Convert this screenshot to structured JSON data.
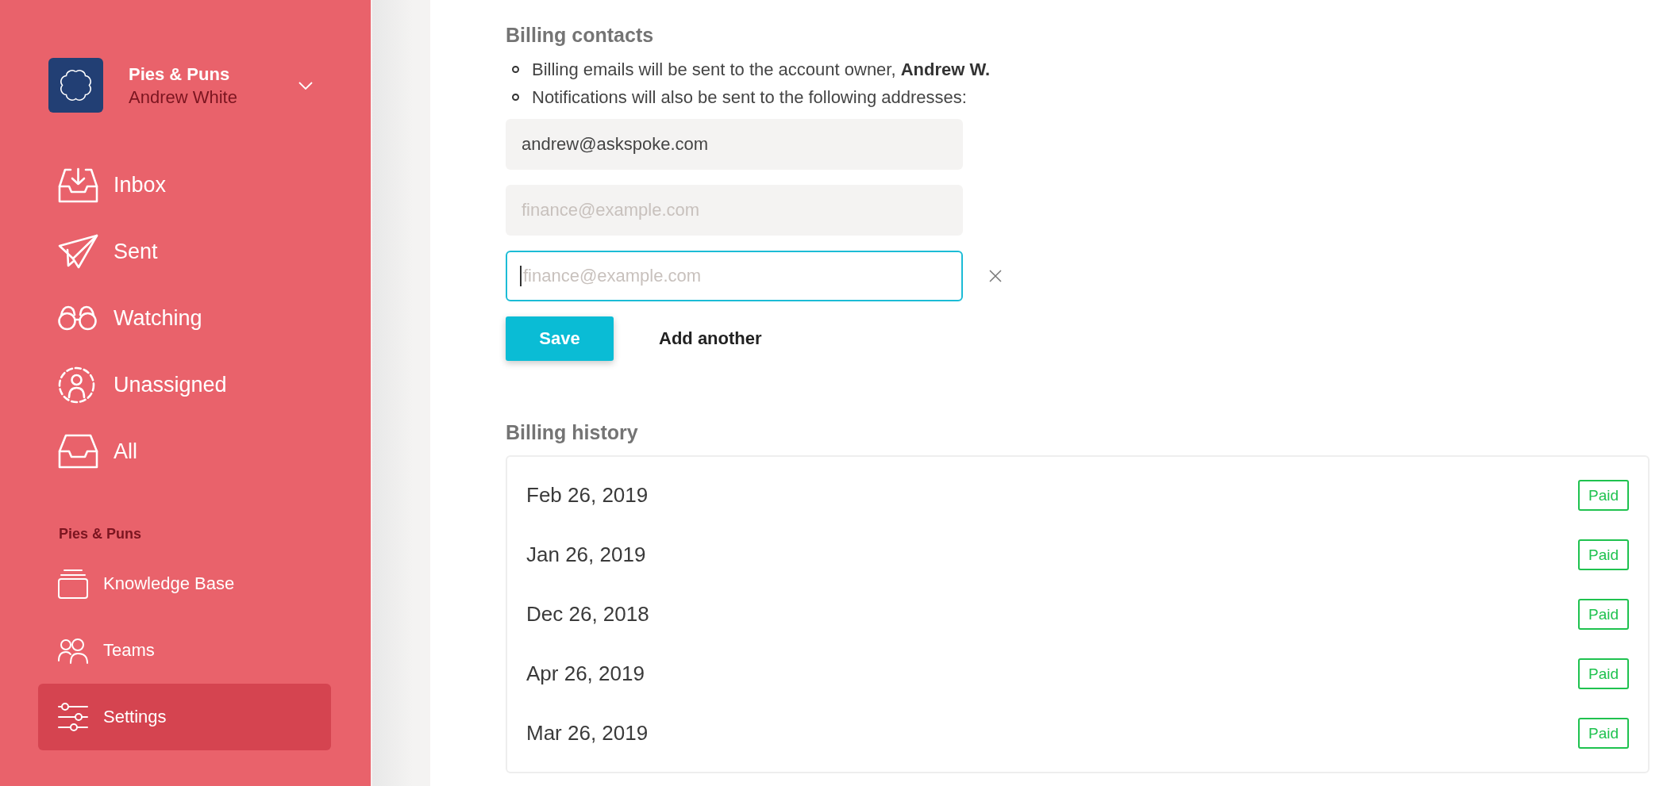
{
  "sidebar": {
    "workspace": {
      "name": "Pies & Puns",
      "user": "Andrew White"
    },
    "nav_items": [
      {
        "label": "Inbox",
        "selected": false
      },
      {
        "label": "Sent",
        "selected": false
      },
      {
        "label": "Watching",
        "selected": false
      },
      {
        "label": "Unassigned",
        "selected": false
      },
      {
        "label": "All",
        "selected": false
      }
    ],
    "section": {
      "title": "Pies & Puns",
      "items": [
        {
          "label": "Knowledge Base",
          "selected": false
        },
        {
          "label": "Teams",
          "selected": false
        },
        {
          "label": "Settings",
          "selected": true
        }
      ]
    }
  },
  "billing_contacts": {
    "title": "Billing contacts",
    "notes": [
      "Billing emails will be sent to the account owner, **Andrew W.**",
      "Notifications will also be sent to the following addresses:"
    ],
    "email_fields": [
      {
        "value": "andrew@askspoke.com",
        "focused": false,
        "removable": false
      },
      {
        "placeholder": "finance@example.com",
        "focused": false,
        "removable": false
      },
      {
        "placeholder": "finance@example.com",
        "focused": true,
        "removable": true
      }
    ],
    "save_button": "Save",
    "add_link": "Add another"
  },
  "billing_history": {
    "title": "Billing history",
    "rows": [
      {
        "date": "Feb 26, 2019",
        "status": "Paid"
      },
      {
        "date": "Jan 26, 2019",
        "status": "Paid"
      },
      {
        "date": "Dec 26, 2018",
        "status": "Paid"
      },
      {
        "date": "Apr 26, 2019",
        "status": "Paid"
      },
      {
        "date": "Mar 26, 2019",
        "status": "Paid"
      }
    ]
  }
}
